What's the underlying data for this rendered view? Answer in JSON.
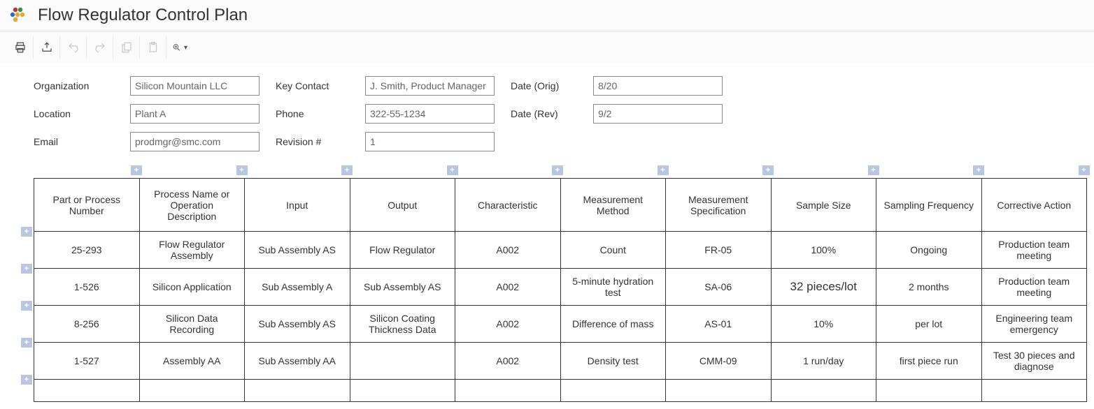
{
  "title": "Flow Regulator Control Plan",
  "form": {
    "organization": {
      "label": "Organization",
      "value": "Silicon Mountain LLC"
    },
    "location": {
      "label": "Location",
      "value": "Plant A"
    },
    "email": {
      "label": "Email",
      "value": "prodmgr@smc.com"
    },
    "key_contact": {
      "label": "Key Contact",
      "value": "J. Smith, Product Manager"
    },
    "phone": {
      "label": "Phone",
      "value": "322-55-1234"
    },
    "revision": {
      "label": "Revision #",
      "value": "1"
    },
    "date_orig": {
      "label": "Date (Orig)",
      "value": "8/20"
    },
    "date_rev": {
      "label": "Date (Rev)",
      "value": "9/2"
    }
  },
  "table": {
    "headers": [
      "Part or Process Number",
      "Process Name or Operation Description",
      "Input",
      "Output",
      "Characteristic",
      "Measurement Method",
      "Measurement Specification",
      "Sample Size",
      "Sampling Frequency",
      "Corrective Action"
    ],
    "rows": [
      [
        "25-293",
        "Flow Regulator Assembly",
        "Sub Assembly AS",
        "Flow Regulator",
        "A002",
        "Count",
        "FR-05",
        "100%",
        "Ongoing",
        "Production team meeting"
      ],
      [
        "1-526",
        "Silicon Application",
        "Sub Assembly A",
        "Sub Assembly AS",
        "A002",
        "5-minute hydration test",
        "SA-06",
        "32 pieces/lot",
        "2 months",
        "Production team meeting"
      ],
      [
        "8-256",
        "Silicon Data Recording",
        "Sub Assembly AS",
        "Silicon Coating Thickness Data",
        "A002",
        "Difference of mass",
        "AS-01",
        "10%",
        "per lot",
        "Engineering team emergency"
      ],
      [
        "1-527",
        "Assembly AA",
        "Sub Assembly AA",
        "",
        "A002",
        "Density test",
        "CMM-09",
        "1 run/day",
        "first piece run",
        "Test 30 pieces and diagnose"
      ]
    ],
    "big_cells": [
      [
        1,
        7
      ]
    ]
  },
  "add_label": "+",
  "add_col_positions": [
    192,
    346,
    496,
    646,
    796,
    946,
    1096,
    1246,
    1396,
    1546
  ],
  "add_row_positions": [
    329,
    384,
    438,
    492,
    546
  ],
  "chart_data": {
    "type": "table",
    "title": "Flow Regulator Control Plan",
    "columns": [
      "Part or Process Number",
      "Process Name or Operation Description",
      "Input",
      "Output",
      "Characteristic",
      "Measurement Method",
      "Measurement Specification",
      "Sample Size",
      "Sampling Frequency",
      "Corrective Action"
    ],
    "rows": [
      [
        "25-293",
        "Flow Regulator Assembly",
        "Sub Assembly AS",
        "Flow Regulator",
        "A002",
        "Count",
        "FR-05",
        "100%",
        "Ongoing",
        "Production team meeting"
      ],
      [
        "1-526",
        "Silicon Application",
        "Sub Assembly A",
        "Sub Assembly AS",
        "A002",
        "5-minute hydration test",
        "SA-06",
        "32 pieces/lot",
        "2 months",
        "Production team meeting"
      ],
      [
        "8-256",
        "Silicon Data Recording",
        "Sub Assembly AS",
        "Silicon Coating Thickness Data",
        "A002",
        "Difference of mass",
        "AS-01",
        "10%",
        "per lot",
        "Engineering team emergency"
      ],
      [
        "1-527",
        "Assembly AA",
        "Sub Assembly AA",
        "",
        "A002",
        "Density test",
        "CMM-09",
        "1 run/day",
        "first piece run",
        "Test 30 pieces and diagnose"
      ]
    ]
  }
}
